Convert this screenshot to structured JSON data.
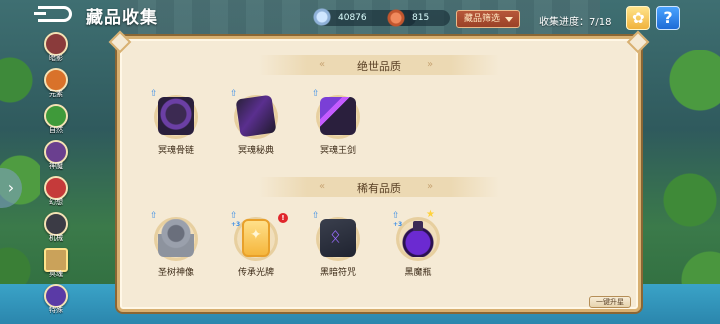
{
  "header": {
    "back_icon": "back-arrow-icon",
    "title": "藏品收集",
    "crystal_amount": "40876",
    "ore_amount": "815",
    "filter_label": "藏品筛选",
    "progress_text": "收集进度：7/18",
    "lotus_icon": "lotus-icon",
    "help_label": "?"
  },
  "sidebar": {
    "items": [
      {
        "label": "暗影",
        "icon": "category-shadow-icon",
        "color": "#8a3b3b"
      },
      {
        "label": "元素",
        "icon": "category-element-icon",
        "color": "#d9722a"
      },
      {
        "label": "自然",
        "icon": "category-nature-icon",
        "color": "#3f9a3a"
      },
      {
        "label": "神魔",
        "icon": "category-demon-icon",
        "color": "#6a3f8f"
      },
      {
        "label": "幻想",
        "icon": "category-fantasy-icon",
        "color": "#c53a3a"
      },
      {
        "label": "机械",
        "icon": "category-machine-icon",
        "color": "#3b3b45"
      },
      {
        "label": "冥魂",
        "icon": "category-soul-icon",
        "color": "#b58a3a"
      },
      {
        "label": "特殊",
        "icon": "category-special-icon",
        "color": "#5a3aa6"
      }
    ],
    "active_index": 6
  },
  "sections": [
    {
      "title": "绝世品质",
      "items": [
        {
          "name": "冥魂骨链",
          "art": "skull-necklace-icon",
          "upgradable": true
        },
        {
          "name": "冥魂秘典",
          "art": "dark-tome-icon",
          "upgradable": true
        },
        {
          "name": "冥魂王剑",
          "art": "soul-sword-icon",
          "upgradable": true
        }
      ]
    },
    {
      "title": "稀有品质",
      "items": [
        {
          "name": "圣树神像",
          "art": "sacred-statue-icon",
          "upgradable": true
        },
        {
          "name": "传承光牌",
          "art": "light-card-icon",
          "upgradable": true,
          "level_badge": "+3",
          "alert": "!"
        },
        {
          "name": "黑暗符咒",
          "art": "dark-rune-icon",
          "upgradable": true
        },
        {
          "name": "黑魔瓶",
          "art": "dark-bottle-icon",
          "upgradable": true,
          "level_badge": "+3",
          "star": true
        }
      ]
    }
  ],
  "footer": {
    "upgrade_all_label": "一键升星"
  }
}
